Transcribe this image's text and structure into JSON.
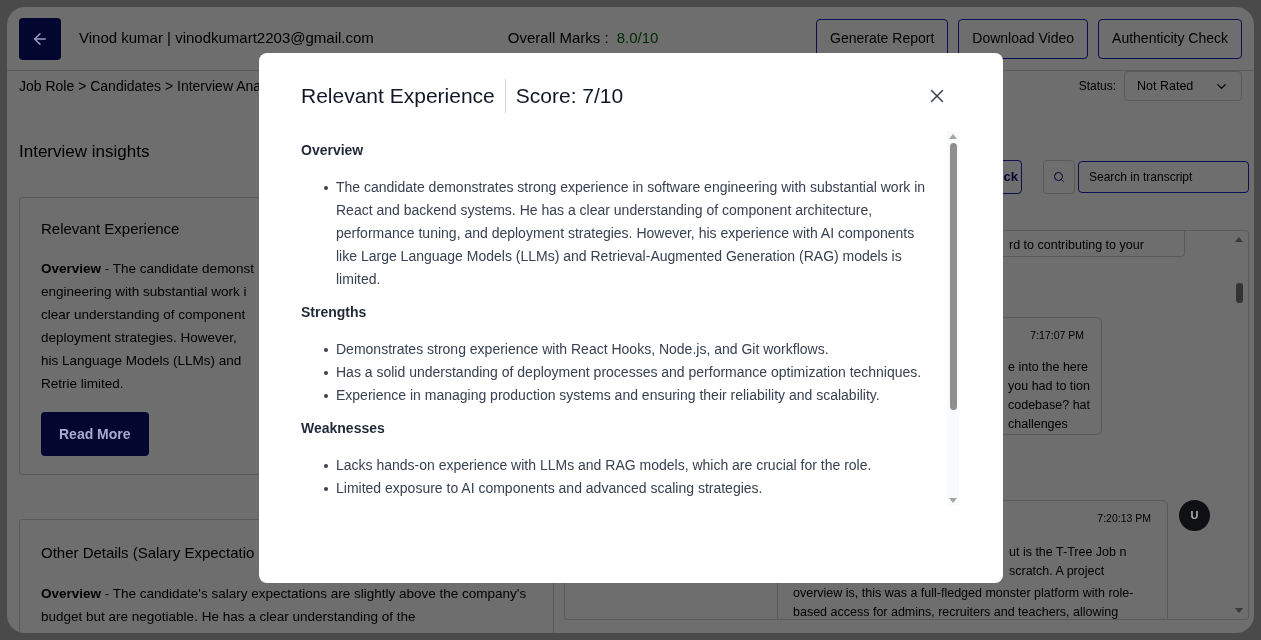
{
  "header": {
    "user": "Vinod kumar | vinodkumart2203@gmail.com",
    "marks_label": "Overall Marks :",
    "marks_value": "8.0/10",
    "actions": [
      "Generate Report",
      "Download Video",
      "Authenticity Check"
    ]
  },
  "breadcrumb": "Job Role > Candidates > Interview Ana",
  "status": {
    "label": "Status:",
    "value": "Not Rated"
  },
  "insights": {
    "title": "Interview insights",
    "cards": [
      {
        "title": "Relevant Experience",
        "text": "**Overview** - The candidate demonst engineering with substantial work i clear understanding of component deployment strategies. However, his Language Models (LLMs) and Retrie limited.",
        "button": "Read More"
      },
      {
        "title": "Other Details (Salary Expectatio",
        "text": "**Overview** - The candidate's salary expectations are slightly above the company's budget but are negotiable. He has a clear understanding of the"
      }
    ]
  },
  "transcript": {
    "button_fragment": "ck",
    "search": {
      "placeholder": "Search in transcript"
    },
    "messages": [
      {
        "text": "rd to contributing to your"
      },
      {
        "time": "7:17:07 PM",
        "text": "e into the here you had to tion codebase? hat challenges"
      },
      {
        "time": "7:20:13 PM",
        "avatar": "U",
        "text": "ut is the T-Tree Job n scratch. A project",
        "text_below": "overview is, this was a full-fledged monster platform with role- based access for admins, recruiters and teachers, allowing"
      }
    ]
  },
  "modal": {
    "title": "Relevant Experience",
    "score": "Score: 7/10",
    "sections": [
      {
        "heading": "Overview",
        "items": [
          "The candidate demonstrates strong experience in software engineering with substantial work in React and backend systems. He has a clear understanding of component architecture, performance tuning, and deployment strategies. However, his experience with AI components like Large Language Models (LLMs) and Retrieval-Augmented Generation (RAG) models is limited."
        ]
      },
      {
        "heading": "Strengths",
        "items": [
          "Demonstrates strong experience with React Hooks, Node.js, and Git workflows.",
          "Has a solid understanding of deployment processes and performance optimization techniques.",
          "Experience in managing production systems and ensuring their reliability and scalability."
        ]
      },
      {
        "heading": "Weaknesses",
        "items": [
          "Lacks hands-on experience with LLMs and RAG models, which are crucial for the role.",
          "Limited exposure to AI components and advanced scaling strategies."
        ]
      }
    ]
  }
}
